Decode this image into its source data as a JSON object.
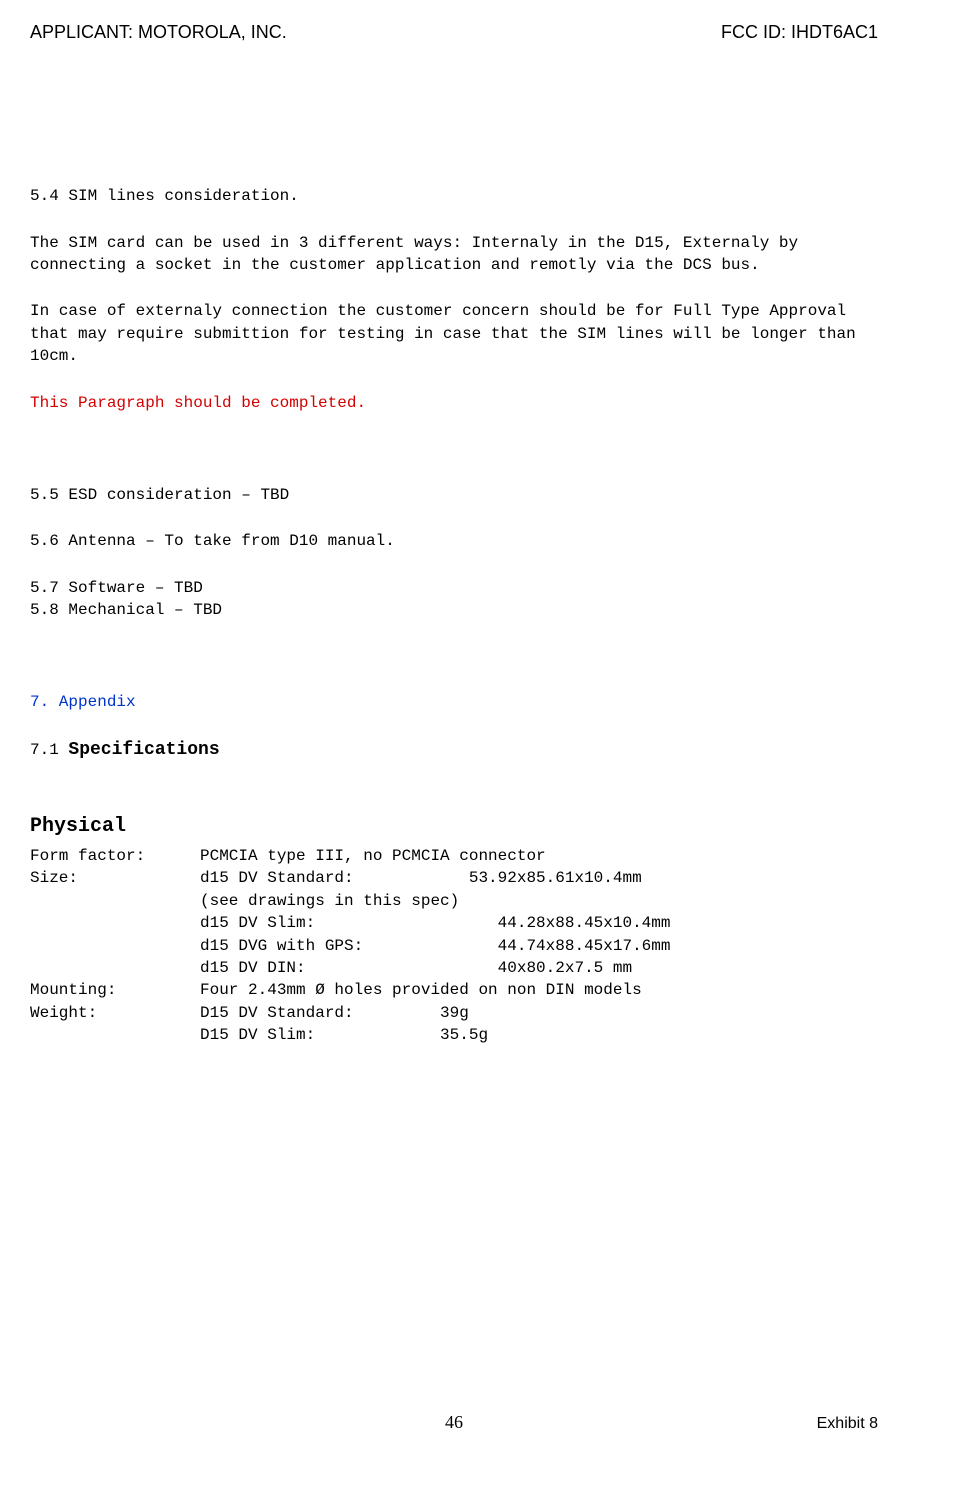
{
  "header": {
    "left": "APPLICANT:  MOTOROLA, INC.",
    "right": "FCC ID: IHDT6AC1"
  },
  "body": {
    "s54_title": "5.4 SIM lines consideration.",
    "s54_p1": "The SIM card can be used in 3 different ways: Internaly in the D15, Externaly by connecting a socket in the customer application and remotly via the DCS bus.",
    "s54_p2": "In case of externaly connection the customer concern should be for Full Type Approval that may require submittion for testing in case that the SIM lines will be longer than 10cm.",
    "s54_red": "This Paragraph should be completed.",
    "s55": "5.5 ESD consideration – TBD",
    "s56": "5.6 Antenna – To take from D10 manual.",
    "s57": "5.7 Software – TBD",
    "s58": "5.8 Mechanical – TBD",
    "appendix": "7. Appendix",
    "spec_title_num": "7.1 ",
    "spec_title_bold": "Specifications",
    "physical": "Physical",
    "form_label": "Form factor:",
    "form_value": "PCMCIA type III, no PCMCIA connector",
    "size_label": "Size:",
    "size_v1": "d15 DV Standard:            53.92x85.61x10.4mm",
    "size_v2": "(see drawings in this spec)",
    "size_v3": "d15 DV Slim:                   44.28x88.45x10.4mm",
    "size_v4": "d15 DVG with GPS:              44.74x88.45x17.6mm",
    "size_v5": "d15 DV DIN:                    40x80.2x7.5 mm",
    "mount_label": "Mounting:",
    "mount_value": "Four 2.43mm Ø holes provided on non DIN models",
    "weight_label": "Weight:",
    "weight_v1": "D15 DV Standard:         39g",
    "weight_v2": "D15 DV Slim:             35.5g"
  },
  "footer": {
    "page": "46",
    "exhibit": "Exhibit 8"
  }
}
